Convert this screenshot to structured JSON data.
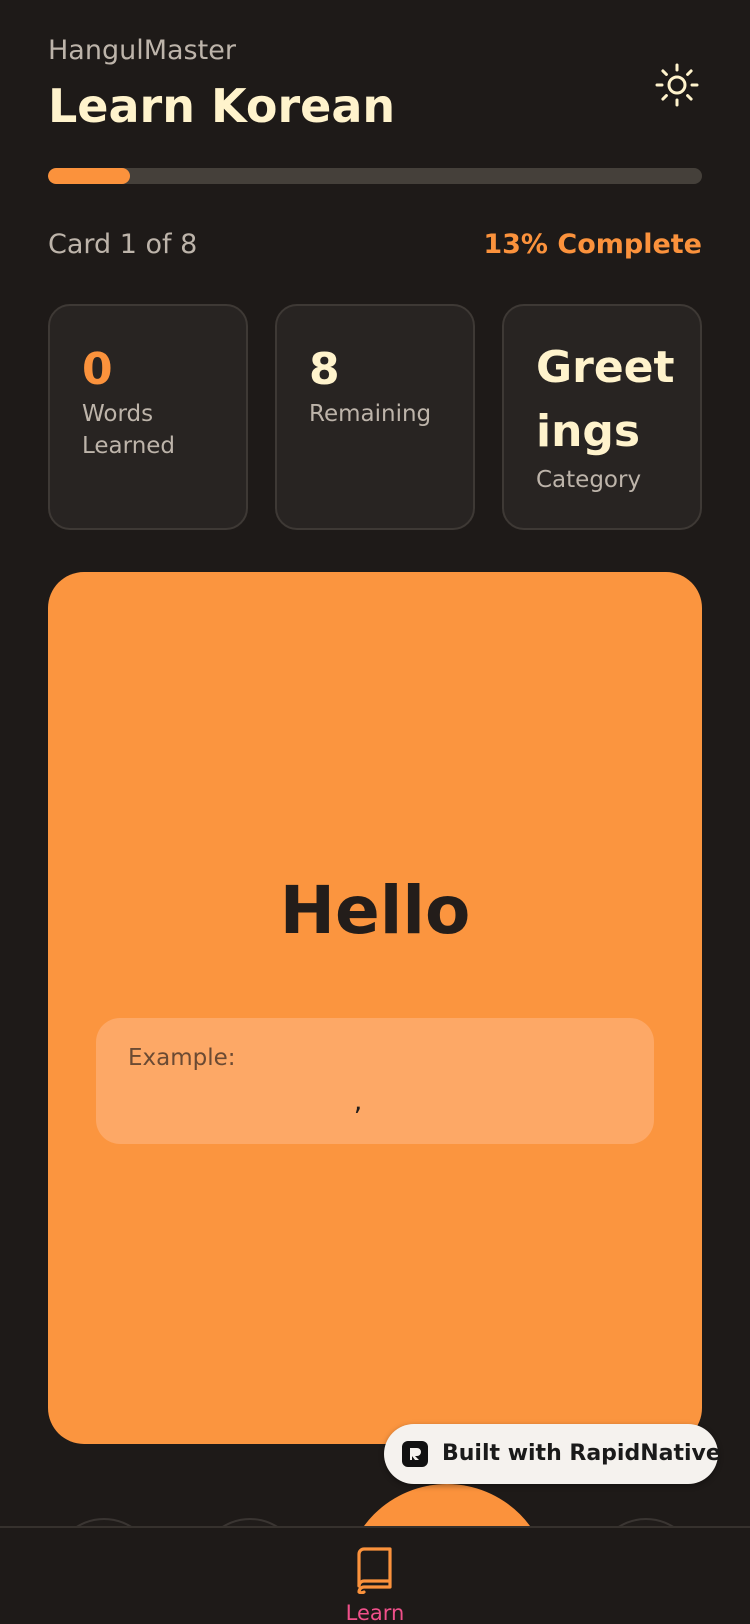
{
  "header": {
    "app_name": "HangulMaster",
    "title": "Learn Korean",
    "theme_icon": "sun-icon"
  },
  "progress": {
    "fraction": 0.125,
    "card_counter": "Card 1 of 8",
    "percent_label": "13% Complete"
  },
  "stats": [
    {
      "value": "0",
      "label": "Words Learned"
    },
    {
      "value": "8",
      "label": "Remaining"
    },
    {
      "value": "Greetings",
      "label": "Category"
    }
  ],
  "flashcard": {
    "word": "Hello",
    "example_label": "Example:",
    "example_text": ","
  },
  "badge": {
    "text": "Built with RapidNative"
  },
  "tabbar": {
    "learn_label": "Learn",
    "learn_icon": "book-icon"
  },
  "colors": {
    "background": "#1E1A18",
    "accent": "#FB923C",
    "title": "#FFF3CC",
    "tab_active": "#F0508A"
  }
}
